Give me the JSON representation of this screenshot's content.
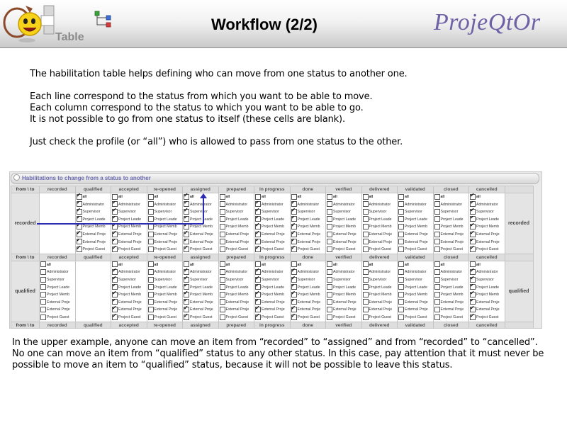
{
  "header": {
    "logo_word": "Table",
    "title": "Workflow (2/2)",
    "brand": "ProjeQtOr",
    "logo_icon": "smiley-mascot-icon",
    "workflow_icon": "workflow-icon"
  },
  "intro": [
    [
      "The habilitation table helps defining who can move from one status to another one."
    ],
    [
      "Each line correspond to the status from which you want to be able to move.",
      "Each column correspond to the status to which you want to be able to go.",
      "It is not possible to go from one status to itself (these cells are blank)."
    ],
    [
      "Just check the profile (or “all”) who is allowed to pass from one status to the other."
    ]
  ],
  "outro": [
    "In the upper example, anyone can move an item from “recorded” to “assigned” and from “recorded” to “cancelled”.",
    "No one can move an item from “qualified” status to any other status. In this case, pay attention that it must never be possible to move an item to “qualified” status, because it will not be possible to leave this status."
  ],
  "panel": {
    "title": "Habilitations to change from a status to another",
    "corner_label": "from \\ to",
    "statuses": [
      "recorded",
      "qualified",
      "accepted",
      "re-opened",
      "assigned",
      "prepared",
      "in progress",
      "done",
      "verified",
      "delivered",
      "validated",
      "closed",
      "cancelled"
    ],
    "profiles": [
      "all",
      "Administrator",
      "Supervisor",
      "Project Leader",
      "Project Member",
      "External Project",
      "External Project",
      "Project Guest"
    ],
    "profile_labels": [
      "all",
      "Administrator",
      "Supervisor",
      "Project Leade",
      "Project Memb",
      "External Proje",
      "External Proje",
      "Project Guest"
    ],
    "rows": [
      {
        "label": "recorded",
        "cells": [
          null,
          [
            true,
            true,
            true,
            true,
            true,
            true,
            true,
            true
          ],
          [
            false,
            true,
            true,
            true,
            true,
            true,
            true,
            true
          ],
          [
            false,
            false,
            false,
            false,
            false,
            false,
            false,
            false
          ],
          [
            true,
            true,
            true,
            true,
            true,
            true,
            true,
            true
          ],
          [
            false,
            false,
            false,
            false,
            false,
            false,
            false,
            false
          ],
          [
            false,
            true,
            true,
            true,
            true,
            true,
            true,
            true
          ],
          [
            false,
            true,
            true,
            true,
            true,
            true,
            true,
            true
          ],
          [
            false,
            false,
            false,
            false,
            false,
            false,
            false,
            false
          ],
          [
            false,
            false,
            false,
            false,
            false,
            false,
            false,
            false
          ],
          [
            false,
            false,
            false,
            false,
            false,
            false,
            false,
            false
          ],
          [
            false,
            false,
            false,
            false,
            false,
            false,
            false,
            false
          ],
          [
            true,
            true,
            true,
            true,
            true,
            true,
            true,
            true
          ]
        ]
      },
      {
        "label": "qualified",
        "cells": [
          [
            false,
            false,
            false,
            false,
            false,
            false,
            false,
            false
          ],
          null,
          [
            false,
            true,
            true,
            true,
            true,
            true,
            true,
            true
          ],
          [
            false,
            false,
            false,
            false,
            false,
            false,
            false,
            false
          ],
          [
            false,
            true,
            true,
            true,
            true,
            true,
            true,
            true
          ],
          [
            false,
            false,
            false,
            false,
            false,
            false,
            false,
            false
          ],
          [
            false,
            true,
            true,
            true,
            true,
            true,
            true,
            true
          ],
          [
            false,
            true,
            true,
            true,
            true,
            true,
            true,
            true
          ],
          [
            false,
            false,
            false,
            false,
            false,
            false,
            false,
            false
          ],
          [
            false,
            false,
            false,
            false,
            false,
            false,
            false,
            false
          ],
          [
            false,
            false,
            false,
            false,
            false,
            false,
            false,
            false
          ],
          [
            false,
            false,
            false,
            false,
            false,
            false,
            false,
            false
          ],
          [
            false,
            true,
            true,
            true,
            true,
            true,
            true,
            true
          ]
        ]
      }
    ],
    "arrow_color": "#2b2bb4"
  }
}
